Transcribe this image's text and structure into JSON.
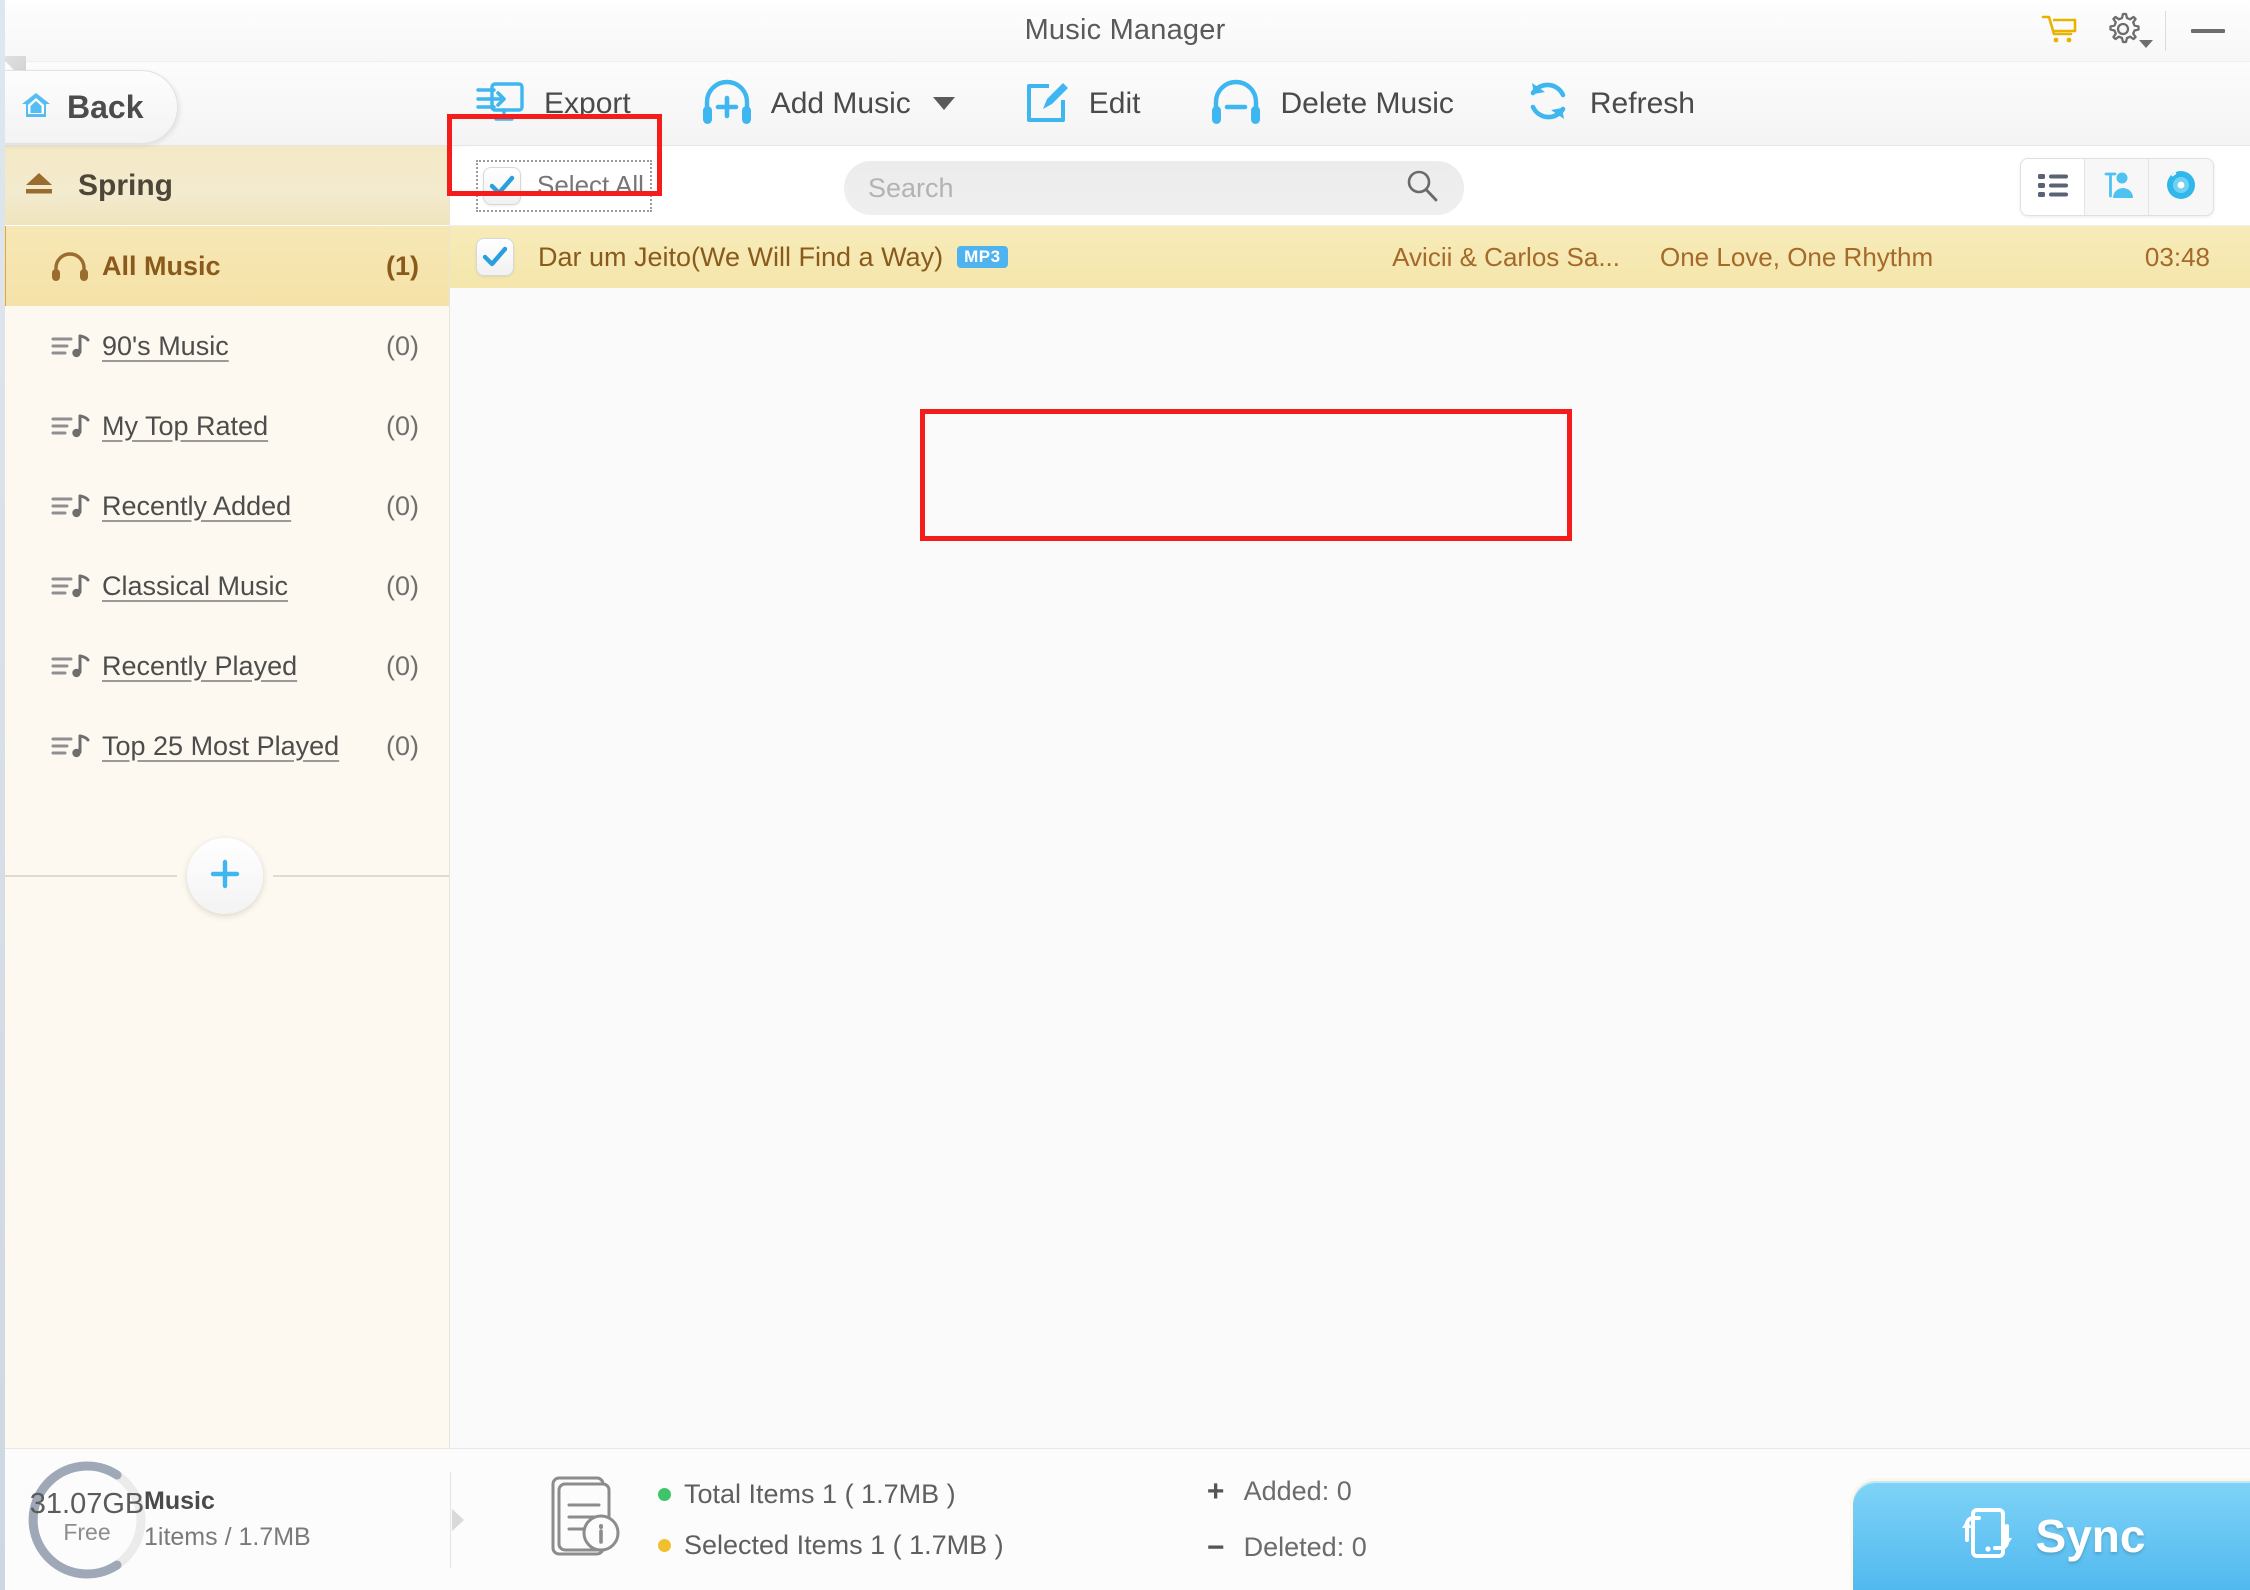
{
  "window": {
    "title": "Music Manager",
    "controls": [
      {
        "name": "cart-icon",
        "label": "Cart"
      },
      {
        "name": "gear-icon",
        "label": "Settings"
      },
      {
        "name": "minimize-button",
        "label": "Minimize"
      }
    ]
  },
  "toolbar": {
    "back_label": "Back",
    "items": [
      {
        "icon": "export-icon",
        "label": "Export",
        "highlighted": true
      },
      {
        "icon": "add-music-icon",
        "label": "Add Music",
        "caret": true
      },
      {
        "icon": "edit-icon",
        "label": "Edit"
      },
      {
        "icon": "delete-music-icon",
        "label": "Delete Music"
      },
      {
        "icon": "refresh-icon",
        "label": "Refresh"
      }
    ]
  },
  "sidebar": {
    "device_name": "Spring",
    "items": [
      {
        "label": "All Music",
        "count": "(1)",
        "icon": "headphones-icon",
        "active": true
      },
      {
        "label": "90's Music",
        "count": "(0)",
        "icon": "playlist-icon",
        "active": false
      },
      {
        "label": "My Top Rated",
        "count": "(0)",
        "icon": "playlist-icon",
        "active": false
      },
      {
        "label": "Recently Added",
        "count": "(0)",
        "icon": "playlist-icon",
        "active": false
      },
      {
        "label": "Classical Music",
        "count": "(0)",
        "icon": "playlist-icon",
        "active": false
      },
      {
        "label": "Recently Played",
        "count": "(0)",
        "icon": "playlist-icon",
        "active": false
      },
      {
        "label": "Top 25 Most Played",
        "count": "(0)",
        "icon": "playlist-icon",
        "active": false
      }
    ],
    "add_playlist_label": "+"
  },
  "list_header": {
    "select_all_label": "Select All",
    "select_all_checked": true,
    "search_placeholder": "Search",
    "search_value": "",
    "view_modes": [
      {
        "name": "list-view",
        "active": true
      },
      {
        "name": "artist-view",
        "active": false
      },
      {
        "name": "album-view",
        "active": false
      }
    ]
  },
  "track_list": {
    "rows": [
      {
        "checked": true,
        "title": "Dar um Jeito(We Will Find a Way)",
        "format": "MP3",
        "artist": "Avicii & Carlos Sa...",
        "album": "One Love, One Rhythm",
        "duration": "03:48"
      }
    ]
  },
  "status_bar": {
    "storage": {
      "free_size": "31.07GB",
      "free_label": "Free",
      "category": "Music",
      "usage": "1items / 1.7MB"
    },
    "totals": {
      "total_items": "Total Items 1 ( 1.7MB )",
      "selected_items": "Selected Items 1 ( 1.7MB )"
    },
    "counters": {
      "added": "Added: 0",
      "added_sign": "+",
      "deleted": "Deleted: 0",
      "deleted_sign": "−"
    },
    "sync_label": "Sync"
  },
  "colors": {
    "accent_blue": "#4fb3f0",
    "highlight_red": "#f51c1c",
    "row_gold": "#f4e6ab",
    "text_brown": "#8a5a1d"
  }
}
